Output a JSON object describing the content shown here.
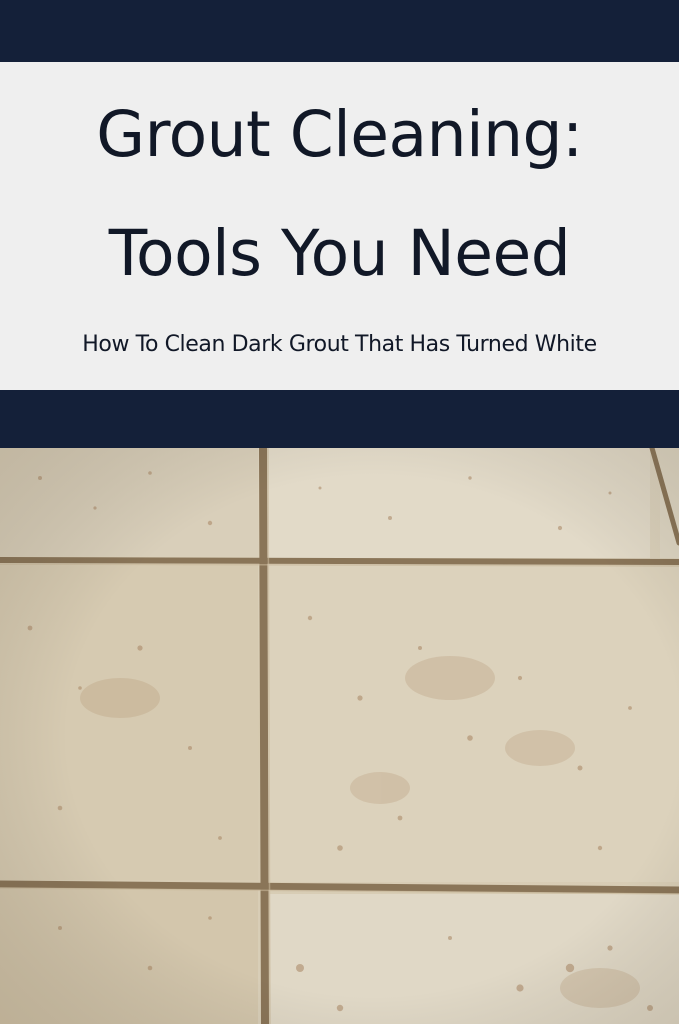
{
  "header": {
    "title_line1": "Grout Cleaning:",
    "title_line2": "Tools You Need",
    "subtitle": "How To Clean Dark Grout That Has Turned White"
  },
  "colors": {
    "navy_band": "#142039",
    "title_panel": "#efefef",
    "title_text": "#111827",
    "tile_base": "#d8cdb5",
    "grout": "#8a7558",
    "stain": "#a88563"
  },
  "photo": {
    "subject": "beige floor tiles with stained grout lines"
  }
}
